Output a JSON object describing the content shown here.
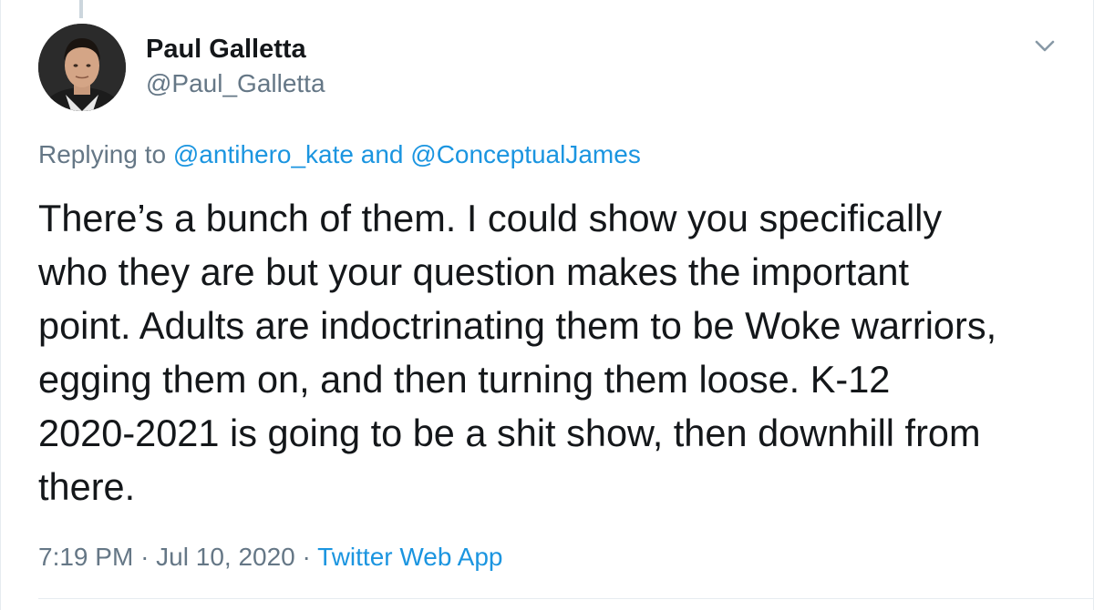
{
  "author": {
    "display_name": "Paul Galletta",
    "handle": "@Paul_Galletta"
  },
  "reply_context": {
    "prefix": "Replying to",
    "user1": "@antihero_kate",
    "conjunction": "and",
    "user2": "@ConceptualJames"
  },
  "tweet_text": "There’s a bunch of them. I could show you specifically\nwho they are but your question makes the important\npoint. Adults are indoctrinating them to be Woke warriors,\negging them on, and then turning them loose. K-12\n2020-2021 is going to be a shit show, then downhill from\nthere.",
  "meta": {
    "time": "7:19 PM",
    "separator1": "·",
    "date": "Jul 10, 2020",
    "separator2": "·",
    "source": "Twitter Web App"
  },
  "icons": {
    "menu_caret": "chevron-down-icon",
    "avatar": "avatar"
  },
  "colors": {
    "link": "#1b95e0",
    "secondary_text": "#657786",
    "primary_text": "#14171a",
    "border": "#e6ecf0"
  }
}
